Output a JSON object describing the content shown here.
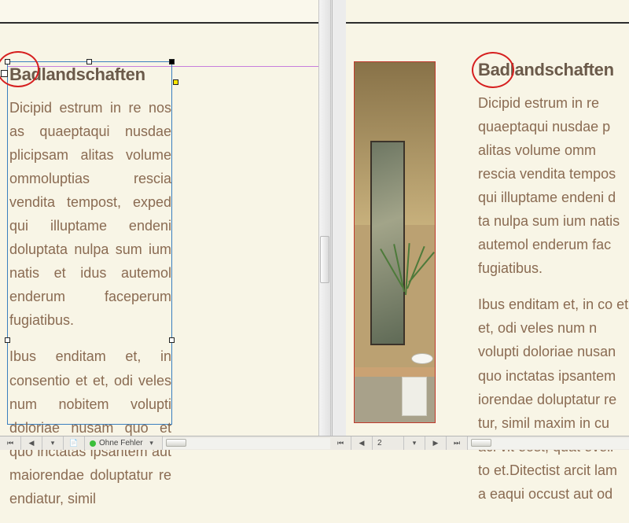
{
  "left_view": {
    "heading": "Badlandschaften",
    "para1": "Dicipid estrum in re nos as quaeptaqui nusdae plicipsam alitas volume ommoluptias rescia vendita tempost, exped qui illuptame endeni doluptata nulpa sum ium natis et idus autemol enderum faceperum fugiatibus.",
    "para2": "Ibus enditam et, in consentio et et, odi veles num nobitem volupti doloriae nusam quo et quo inctatas ipsantem aut maiorendae doluptatur re endiatur, simil"
  },
  "right_view": {
    "heading": "Badlandschaften",
    "para1": "Dicipid estrum in re quaeptaqui nusdae p alitas volume omm rescia vendita tempos qui illuptame endeni d ta nulpa sum ium natis autemol enderum fac fugiatibus.",
    "para2": "Ibus enditam et, in co et et, odi veles num n volupti doloriae nusan quo inctatas ipsantem iorendae doluptatur re tur, simil maxim in cu aci vit eost, quat eveli to et.Ditectist arcit lam a eaqui occust aut od"
  },
  "status_left": {
    "errors_label": "Ohne Fehler"
  },
  "status_right": {
    "page_number": "2"
  },
  "icons": {
    "first": "⏮",
    "prev": "◀",
    "next": "▶",
    "last": "⏭",
    "dropdown": "▾",
    "doc": "📄",
    "refresh": "⟳"
  }
}
